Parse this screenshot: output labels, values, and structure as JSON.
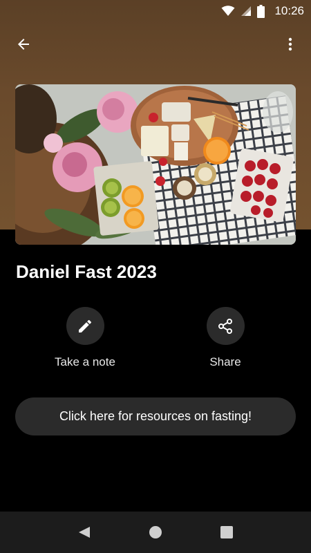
{
  "status_bar": {
    "time": "10:26",
    "icons": [
      "wifi-icon",
      "signal-icon",
      "battery-icon"
    ]
  },
  "appbar": {
    "back_icon": "arrow-back-icon",
    "more_icon": "more-vert-icon"
  },
  "cover": {
    "description_icon": "cover-image"
  },
  "plan": {
    "title": "Daniel Fast 2023"
  },
  "actions": [
    {
      "label": "Take a note",
      "icon": "pencil-icon"
    },
    {
      "label": "Share",
      "icon": "share-icon"
    }
  ],
  "resources": {
    "button_label": "Click here for resources on fasting!"
  },
  "navbar": {
    "icons": [
      "nav-back-icon",
      "nav-home-icon",
      "nav-recents-icon"
    ]
  },
  "colors": {
    "hero_background": "#6a4a2c",
    "page_background": "#000000",
    "button_background": "#2b2b2b",
    "navbar_background": "#1c1c1c"
  }
}
